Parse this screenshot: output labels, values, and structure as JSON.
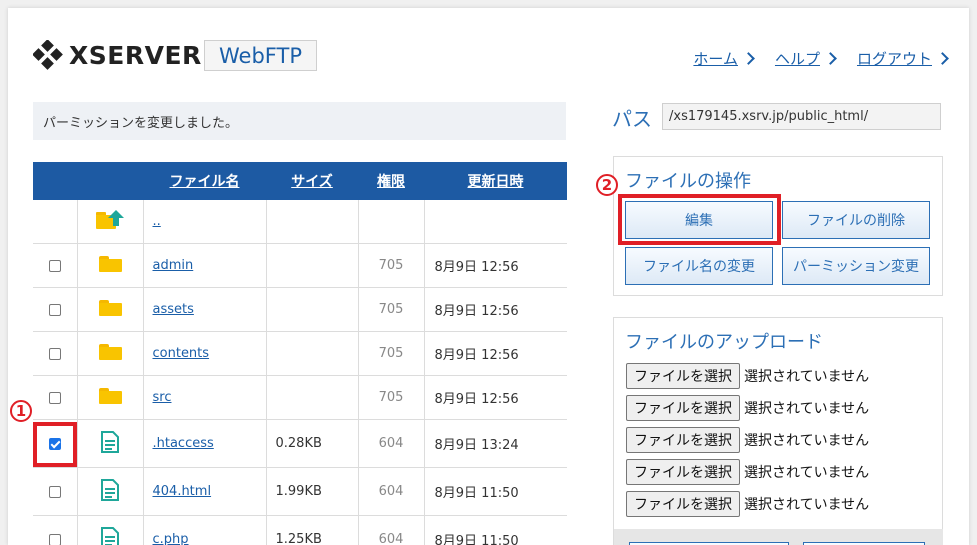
{
  "header": {
    "logo_text": "XSERVER",
    "badge": "WebFTP",
    "nav": [
      "ホーム",
      "ヘルプ",
      "ログアウト"
    ]
  },
  "message": "パーミッションを変更しました。",
  "table": {
    "headers": [
      "ファイル名",
      "サイズ",
      "権限",
      "更新日時"
    ],
    "parent": "..",
    "rows": [
      {
        "name": "admin",
        "type": "folder",
        "size": "",
        "perm": "705",
        "date": "8月9日 12:56",
        "checked": false
      },
      {
        "name": "assets",
        "type": "folder",
        "size": "",
        "perm": "705",
        "date": "8月9日 12:56",
        "checked": false
      },
      {
        "name": "contents",
        "type": "folder",
        "size": "",
        "perm": "705",
        "date": "8月9日 12:56",
        "checked": false
      },
      {
        "name": "src",
        "type": "folder",
        "size": "",
        "perm": "705",
        "date": "8月9日 12:56",
        "checked": false
      },
      {
        "name": ".htaccess",
        "type": "file",
        "size": "0.28KB",
        "perm": "604",
        "date": "8月9日 13:24",
        "checked": true
      },
      {
        "name": "404.html",
        "type": "file",
        "size": "1.99KB",
        "perm": "604",
        "date": "8月9日 11:50",
        "checked": false
      },
      {
        "name": "c.php",
        "type": "file",
        "size": "1.25KB",
        "perm": "604",
        "date": "8月9日 11:50",
        "checked": false
      }
    ]
  },
  "path": {
    "label": "パス",
    "value": "/xs179145.xsrv.jp/public_html/"
  },
  "operations": {
    "title": "ファイルの操作",
    "edit": "編集",
    "delete": "ファイルの削除",
    "rename": "ファイル名の変更",
    "permission": "パーミッション変更"
  },
  "upload": {
    "title": "ファイルのアップロード",
    "choose": "ファイルを選択",
    "none": "選択されていません"
  },
  "annotations": {
    "one": "1",
    "two": "2"
  },
  "colors": {
    "header_blue": "#1d5aa3",
    "accent": "#2c6fb5",
    "highlight": "#e01f26",
    "folder": "#f9c400",
    "file": "#1fa79a"
  }
}
